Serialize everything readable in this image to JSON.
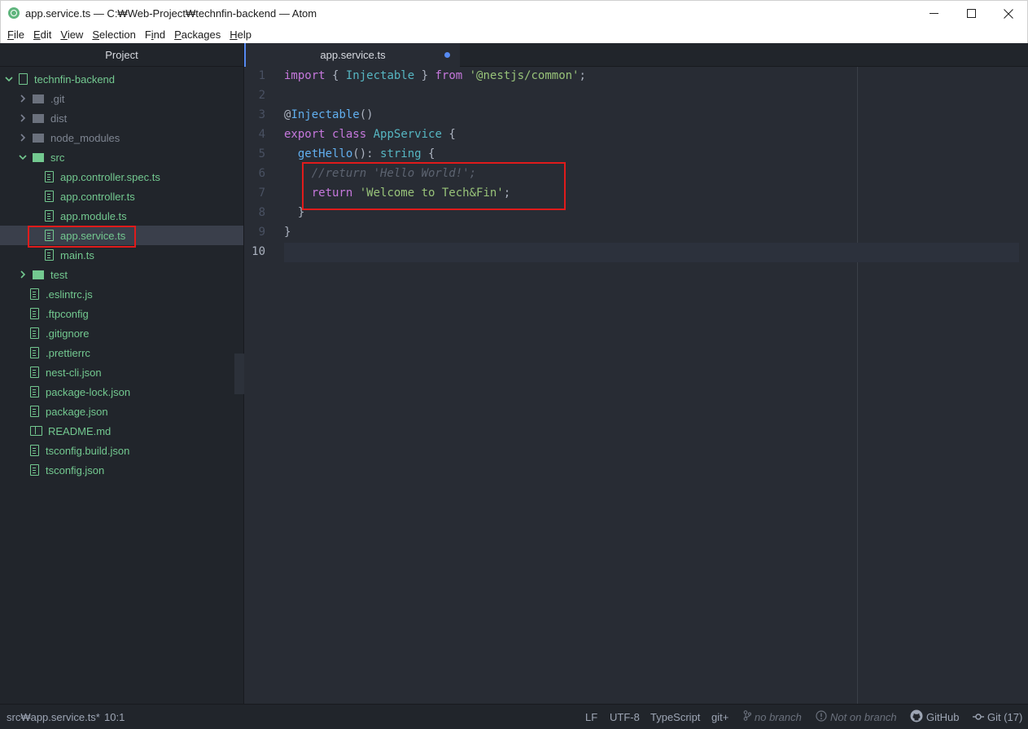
{
  "window": {
    "title": "app.service.ts — C:₩Web-Project₩technfin-backend — Atom"
  },
  "menu": [
    {
      "pre": "",
      "ul": "F",
      "post": "ile"
    },
    {
      "pre": "",
      "ul": "E",
      "post": "dit"
    },
    {
      "pre": "",
      "ul": "V",
      "post": "iew"
    },
    {
      "pre": "",
      "ul": "S",
      "post": "election"
    },
    {
      "pre": "F",
      "ul": "i",
      "post": "nd"
    },
    {
      "pre": "",
      "ul": "P",
      "post": "ackages"
    },
    {
      "pre": "",
      "ul": "H",
      "post": "elp"
    }
  ],
  "tree": {
    "header": "Project",
    "root": "technfin-backend",
    "items": [
      {
        "label": ".git",
        "kind": "folder",
        "expanded": false,
        "depth": 1
      },
      {
        "label": "dist",
        "kind": "folder",
        "expanded": false,
        "depth": 1
      },
      {
        "label": "node_modules",
        "kind": "folder",
        "expanded": false,
        "depth": 1
      },
      {
        "label": "src",
        "kind": "folder",
        "expanded": true,
        "depth": 1
      },
      {
        "label": "app.controller.spec.ts",
        "kind": "file",
        "depth": 2
      },
      {
        "label": "app.controller.ts",
        "kind": "file",
        "depth": 2
      },
      {
        "label": "app.module.ts",
        "kind": "file",
        "depth": 2
      },
      {
        "label": "app.service.ts",
        "kind": "file",
        "depth": 2,
        "selected": true
      },
      {
        "label": "main.ts",
        "kind": "file",
        "depth": 2
      },
      {
        "label": "test",
        "kind": "folder",
        "expanded": false,
        "depth": 1
      },
      {
        "label": ".eslintrc.js",
        "kind": "file",
        "depth": 1
      },
      {
        "label": ".ftpconfig",
        "kind": "file",
        "depth": 1
      },
      {
        "label": ".gitignore",
        "kind": "file",
        "depth": 1
      },
      {
        "label": ".prettierrc",
        "kind": "file",
        "depth": 1
      },
      {
        "label": "nest-cli.json",
        "kind": "file",
        "depth": 1
      },
      {
        "label": "package-lock.json",
        "kind": "file",
        "depth": 1
      },
      {
        "label": "package.json",
        "kind": "file",
        "depth": 1
      },
      {
        "label": "README.md",
        "kind": "book",
        "depth": 1
      },
      {
        "label": "tsconfig.build.json",
        "kind": "file",
        "depth": 1
      },
      {
        "label": "tsconfig.json",
        "kind": "file",
        "depth": 1
      }
    ]
  },
  "editor": {
    "tab": "app.service.ts",
    "modified": true,
    "cursor_line": 10,
    "lines": [
      [
        {
          "c": "k",
          "t": "import"
        },
        {
          "c": "p",
          "t": " { "
        },
        {
          "c": "t",
          "t": "Injectable"
        },
        {
          "c": "p",
          "t": " } "
        },
        {
          "c": "k",
          "t": "from"
        },
        {
          "c": "p",
          "t": " "
        },
        {
          "c": "s",
          "t": "'@nestjs/common'"
        },
        {
          "c": "p",
          "t": ";"
        }
      ],
      [],
      [
        {
          "c": "p",
          "t": "@"
        },
        {
          "c": "f",
          "t": "Injectable"
        },
        {
          "c": "p",
          "t": "()"
        }
      ],
      [
        {
          "c": "k",
          "t": "export"
        },
        {
          "c": "p",
          "t": " "
        },
        {
          "c": "k",
          "t": "class"
        },
        {
          "c": "p",
          "t": " "
        },
        {
          "c": "t",
          "t": "AppService"
        },
        {
          "c": "p",
          "t": " {"
        }
      ],
      [
        {
          "c": "p",
          "t": "  "
        },
        {
          "c": "f",
          "t": "getHello"
        },
        {
          "c": "p",
          "t": "(): "
        },
        {
          "c": "t",
          "t": "string"
        },
        {
          "c": "p",
          "t": " {"
        }
      ],
      [
        {
          "c": "p",
          "t": "    "
        },
        {
          "c": "cm",
          "t": "//return 'Hello World!';"
        }
      ],
      [
        {
          "c": "p",
          "t": "    "
        },
        {
          "c": "k",
          "t": "return"
        },
        {
          "c": "p",
          "t": " "
        },
        {
          "c": "s",
          "t": "'Welcome to Tech&Fin'"
        },
        {
          "c": "p",
          "t": ";"
        }
      ],
      [
        {
          "c": "p",
          "t": "  }"
        }
      ],
      [
        {
          "c": "p",
          "t": "}"
        }
      ],
      []
    ]
  },
  "status": {
    "path": "src₩app.service.ts*",
    "position": "10:1",
    "line_ending": "LF",
    "encoding": "UTF-8",
    "grammar": "TypeScript",
    "git_plus": "git+",
    "branch": "no branch",
    "not_on_branch": "Not on branch",
    "github": "GitHub",
    "git": "Git (17)"
  }
}
